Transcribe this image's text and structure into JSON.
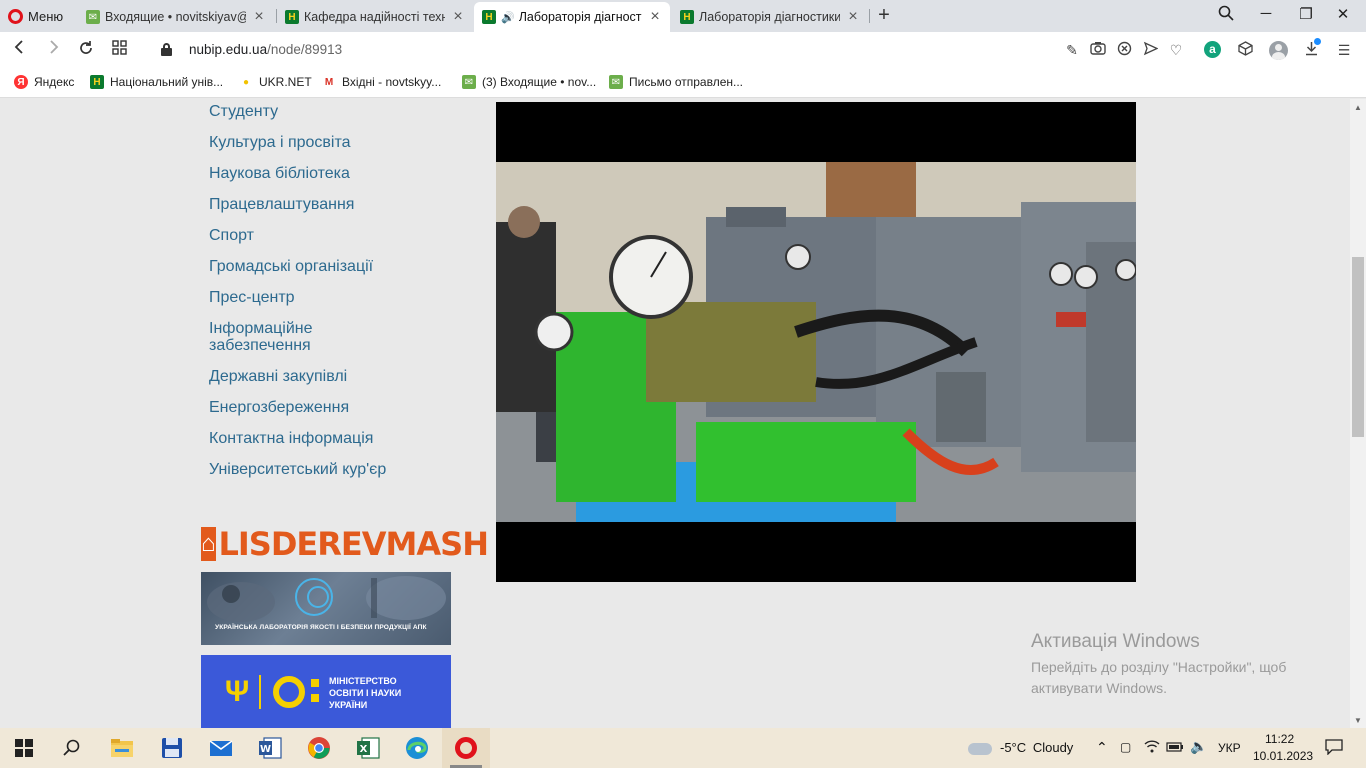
{
  "browser": {
    "menu_label": "Меню",
    "tabs": [
      {
        "title": "Входящие • novitskiyav@u",
        "favicon": "mail"
      },
      {
        "title": "Кафедра надійності технік",
        "favicon": "nubip"
      },
      {
        "title": "Лабораторія діагности",
        "favicon": "nubip",
        "active": true,
        "audio": true
      },
      {
        "title": "Лабораторія діагностики",
        "favicon": "nubip"
      }
    ],
    "url_domain": "nubip.edu.ua",
    "url_path": "/node/89913"
  },
  "bookmarks": [
    {
      "label": "Яндекс",
      "icon": "yandex-icon"
    },
    {
      "label": "Національний унів...",
      "icon": "nubip-icon"
    },
    {
      "label": "UKR.NET",
      "icon": "ukrnet-icon"
    },
    {
      "label": "Вхідні - novtskyy...",
      "icon": "gmail-icon"
    },
    {
      "label": "(3) Входящие • nov...",
      "icon": "mail-icon"
    },
    {
      "label": "Письмо отправлен...",
      "icon": "mail-icon"
    }
  ],
  "sidebar": {
    "items": [
      {
        "label": "Студенту"
      },
      {
        "label": "Культура і просвіта"
      },
      {
        "label": "Наукова бібліотека"
      },
      {
        "label": "Працевлаштування"
      },
      {
        "label": "Спорт"
      },
      {
        "label": "Громадські організації"
      },
      {
        "label": "Прес-центр"
      },
      {
        "label": "Інформаційне"
      },
      {
        "label": "забезпечення"
      },
      {
        "label": "Державні закупівлі"
      },
      {
        "label": "Енергозбереження"
      },
      {
        "label": "Контактна інформація"
      },
      {
        "label": "Університетський кур'єр"
      }
    ]
  },
  "banners": {
    "lisd_text": "LISDEREVMASH",
    "lab_caption": "УКРАЇНСЬКА ЛАБОРАТОРІЯ ЯКОСТІ І БЕЗПЕКИ ПРОДУКЦІЇ АПК",
    "mon_line1": "МІНІСТЕРСТВО",
    "mon_line2": "ОСВІТИ І НАУКИ",
    "mon_line3": "УКРАЇНИ"
  },
  "activation": {
    "title": "Активація Windows",
    "line1": "Перейдіть до розділу \"Настройки\", щоб",
    "line2": "активувати Windows."
  },
  "taskbar": {
    "weather_temp": "-5°C",
    "weather_desc": "Cloudy",
    "lang": "УКР",
    "time": "11:22",
    "date": "10.01.2023"
  },
  "colors": {
    "link": "#2d6a8f",
    "accent_opera": "#e0121b",
    "lisd_orange": "#e25a1c",
    "mon_blue": "#3b59d9",
    "mon_yellow": "#f5d000"
  }
}
